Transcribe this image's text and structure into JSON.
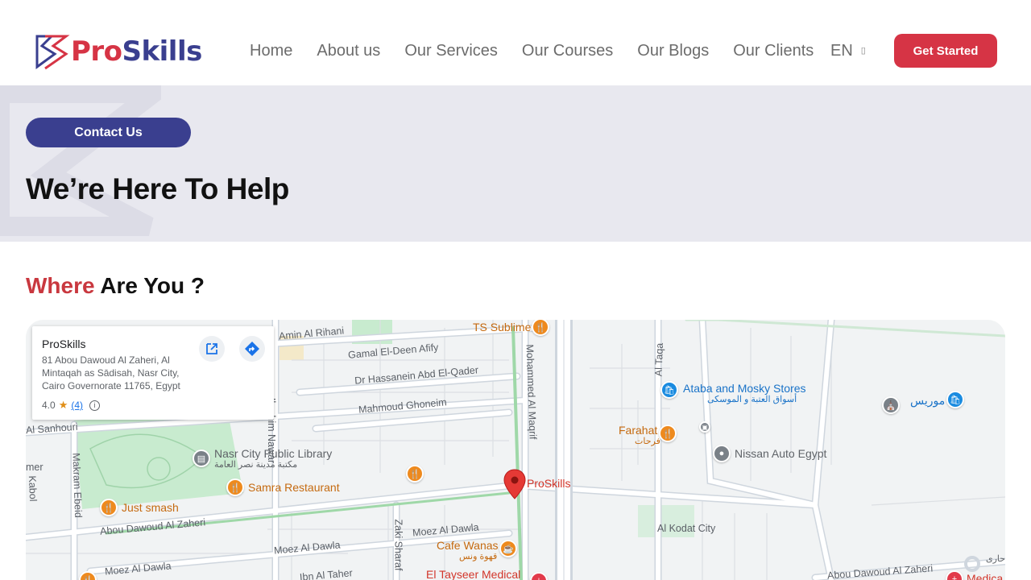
{
  "brand": {
    "part1": "Pro",
    "part2": "Skills"
  },
  "nav": {
    "items": [
      "Home",
      "About us",
      "Our Services",
      "Our Courses",
      "Our Blogs",
      "Our Clients"
    ],
    "lang": "EN",
    "lang_caret": "▯",
    "cta": "Get Started"
  },
  "hero": {
    "pill": "Contact Us",
    "title": "We’re Here To Help"
  },
  "section": {
    "title_accent": "Where",
    "title_rest": " Are You ?"
  },
  "map": {
    "card": {
      "name": "ProSkills",
      "address": "81 Abou Dawoud Al Zaheri, Al Mintaqah as Sādisah, Nasr City, Cairo Governorate 11765, Egypt",
      "rating": "4.0",
      "star": "★",
      "reviews": "(4)",
      "info": "i"
    },
    "streets": {
      "amin": "Amin Al Rihani",
      "gamal": "Gamal El-Deen Afify",
      "hassanein": "Dr Hassanein Abd El-Qader",
      "mahmoud": "Mahmoud Ghoneim",
      "mohammed": "Mohammed Al Maqrif",
      "taqa": "Al Taqa",
      "sanhouri": "Al Sanhouri",
      "ibrahim": "Ibrahim Nawar",
      "makram": "Makram Ebeid",
      "kabol": "Kabol",
      "zaheri1": "Abou Dawoud Al Zaheri",
      "zaheri2": "Abou Dawoud Al Zaheri",
      "moez": "Moez Al Dawla",
      "moez2": "Moez Al Dawla",
      "moez3": "Moez Al Dawla",
      "zaki": "Zaki Sharaf",
      "kodat": "Al Kodat City",
      "ibntaher": "Ibn Al Taher",
      "mer": "mer"
    },
    "pois": {
      "ts": "TS Sublime",
      "ataba": "Ataba and Mosky Stores",
      "ataba_ar": "أسواق العتبة و الموسكى",
      "farahat": "Farahat",
      "farahat_ar": "فرحات",
      "morris": "موريس",
      "nissan": "Nissan Auto Egypt",
      "library": "Nasr City Public Library",
      "library_ar": "مكتبة مدينة نصر العامة",
      "samra": "Samra Restaurant",
      "justsmash": "Just smash",
      "proskills": "ProSkills",
      "cafe": "Cafe Wanas",
      "cafe_ar": "قهوة ونس",
      "tayseer": "El Tayseer Medical",
      "medica": "Medica",
      "ar_right": "حارى"
    }
  }
}
